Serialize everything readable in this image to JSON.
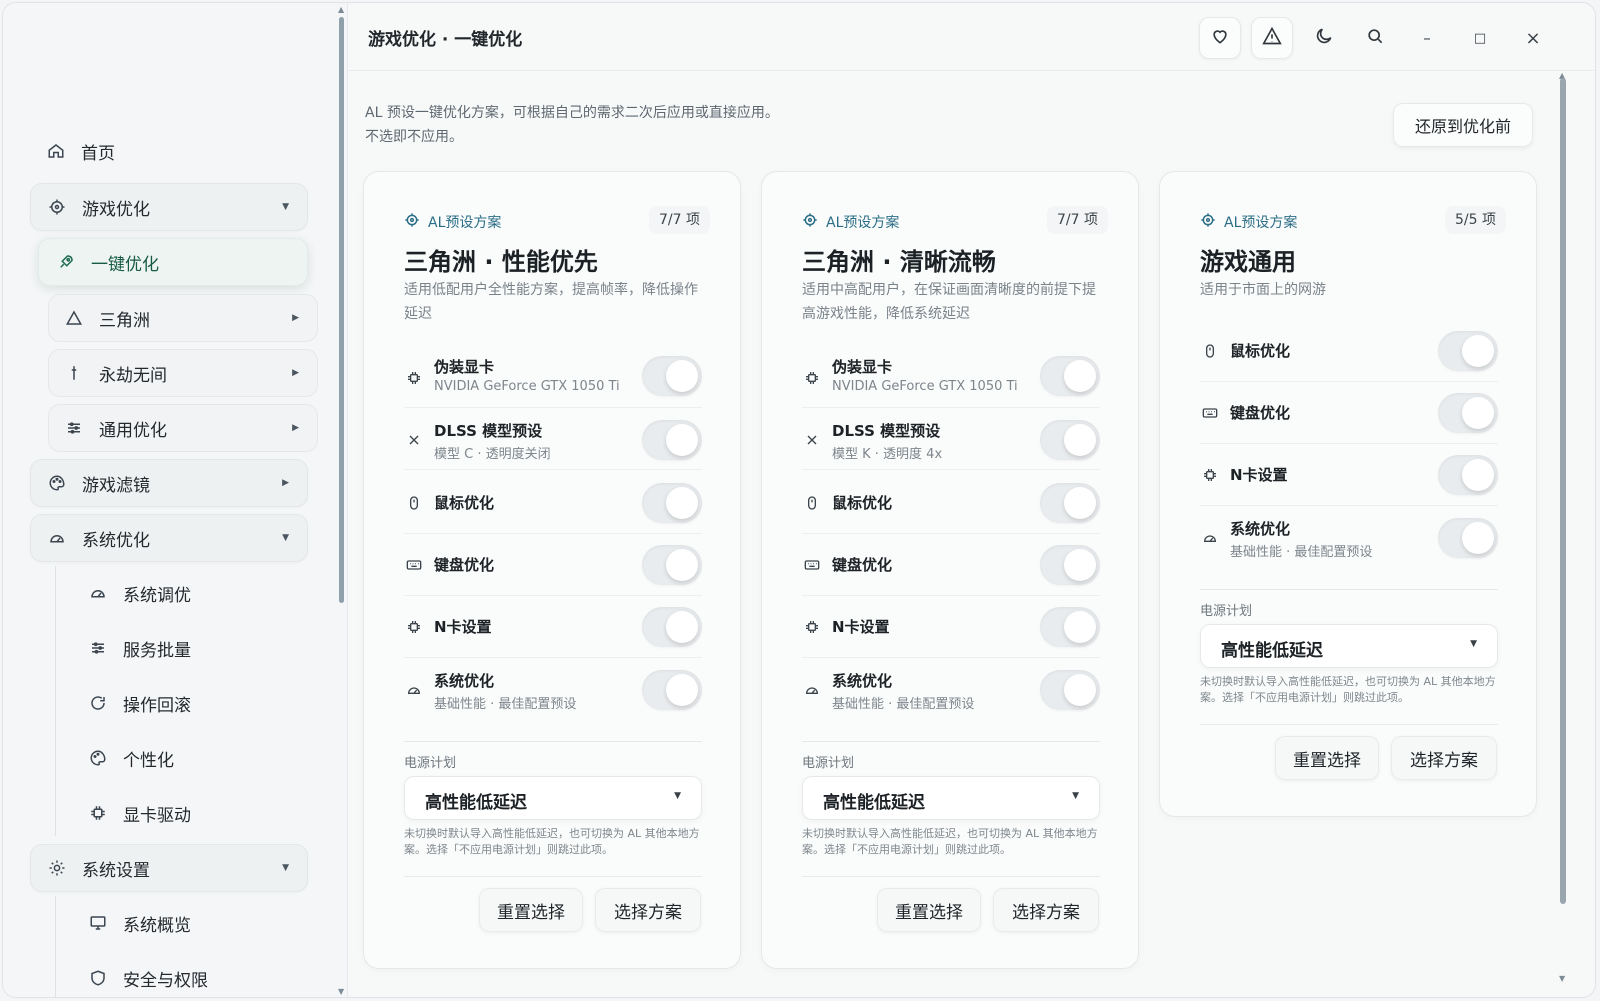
{
  "app": {
    "title": "游戏优化 · 一键优化"
  },
  "sidebar": {
    "home": "首页",
    "game_opt": "游戏优化",
    "one_click": "一键优化",
    "delta": "三角洲",
    "naraka": "永劫无间",
    "general": "通用优化",
    "filter": "游戏滤镜",
    "sys_opt": "系统优化",
    "sys_tune": "系统调优",
    "services": "服务批量",
    "rollback": "操作回滚",
    "personal": "个性化",
    "gpu_driver": "显卡驱动",
    "sys_settings": "系统设置",
    "sys_overview": "系统概览",
    "security": "安全与权限"
  },
  "toolbar": {
    "minimize": "–",
    "maximize": "□",
    "close": "×"
  },
  "main": {
    "desc1": "AL 预设一键优化方案，可根据自己的需求二次后应用或直接应用。",
    "desc2": "不选即不应用。",
    "restore": "还原到优化前"
  },
  "cards": [
    {
      "tag": "AL预设方案",
      "count": "7/7 项",
      "title": "三角洲 · 性能优先",
      "subtitle": "适用低配用户全性能方案，提高帧率，降低操作延迟",
      "options": [
        {
          "name": "伪装显卡",
          "desc": "NVIDIA GeForce GTX 1050 Ti",
          "icon": "chip-icon"
        },
        {
          "name": "DLSS 模型预设",
          "desc": "模型 C · 透明度关闭",
          "icon": "x-icon"
        },
        {
          "name": "鼠标优化",
          "desc": "",
          "icon": "mouse-icon"
        },
        {
          "name": "键盘优化",
          "desc": "",
          "icon": "keyboard-icon"
        },
        {
          "name": "N卡设置",
          "desc": "",
          "icon": "chip-icon"
        },
        {
          "name": "系统优化",
          "desc": "基础性能 · 最佳配置预设",
          "icon": "gauge-icon"
        }
      ],
      "power_label": "电源计划",
      "power_value": "高性能低延迟",
      "note": "未切换时默认导入高性能低延迟，也可切换为 AL 其他本地方案。选择「不应用电源计划」则跳过此项。",
      "reset": "重置选择",
      "choose": "选择方案"
    },
    {
      "tag": "AL预设方案",
      "count": "7/7 项",
      "title": "三角洲 · 清晰流畅",
      "subtitle": "适用中高配用户，在保证画面清晰度的前提下提高游戏性能，降低系统延迟",
      "options": [
        {
          "name": "伪装显卡",
          "desc": "NVIDIA GeForce GTX 1050 Ti",
          "icon": "chip-icon"
        },
        {
          "name": "DLSS 模型预设",
          "desc": "模型 K · 透明度 4x",
          "icon": "x-icon"
        },
        {
          "name": "鼠标优化",
          "desc": "",
          "icon": "mouse-icon"
        },
        {
          "name": "键盘优化",
          "desc": "",
          "icon": "keyboard-icon"
        },
        {
          "name": "N卡设置",
          "desc": "",
          "icon": "chip-icon"
        },
        {
          "name": "系统优化",
          "desc": "基础性能 · 最佳配置预设",
          "icon": "gauge-icon"
        }
      ],
      "power_label": "电源计划",
      "power_value": "高性能低延迟",
      "note": "未切换时默认导入高性能低延迟，也可切换为 AL 其他本地方案。选择「不应用电源计划」则跳过此项。",
      "reset": "重置选择",
      "choose": "选择方案"
    },
    {
      "tag": "AL预设方案",
      "count": "5/5 项",
      "title": "游戏通用",
      "subtitle": "适用于市面上的网游",
      "options": [
        {
          "name": "鼠标优化",
          "desc": "",
          "icon": "mouse-icon"
        },
        {
          "name": "键盘优化",
          "desc": "",
          "icon": "keyboard-icon"
        },
        {
          "name": "N卡设置",
          "desc": "",
          "icon": "chip-icon"
        },
        {
          "name": "系统优化",
          "desc": "基础性能 · 最佳配置预设",
          "icon": "gauge-icon"
        }
      ],
      "power_label": "电源计划",
      "power_value": "高性能低延迟",
      "note": "未切换时默认导入高性能低延迟，也可切换为 AL 其他本地方案。选择「不应用电源计划」则跳过此项。",
      "reset": "重置选择",
      "choose": "选择方案"
    }
  ],
  "colors": {
    "accent": "#1f6b52",
    "tag": "#2a6d86"
  }
}
